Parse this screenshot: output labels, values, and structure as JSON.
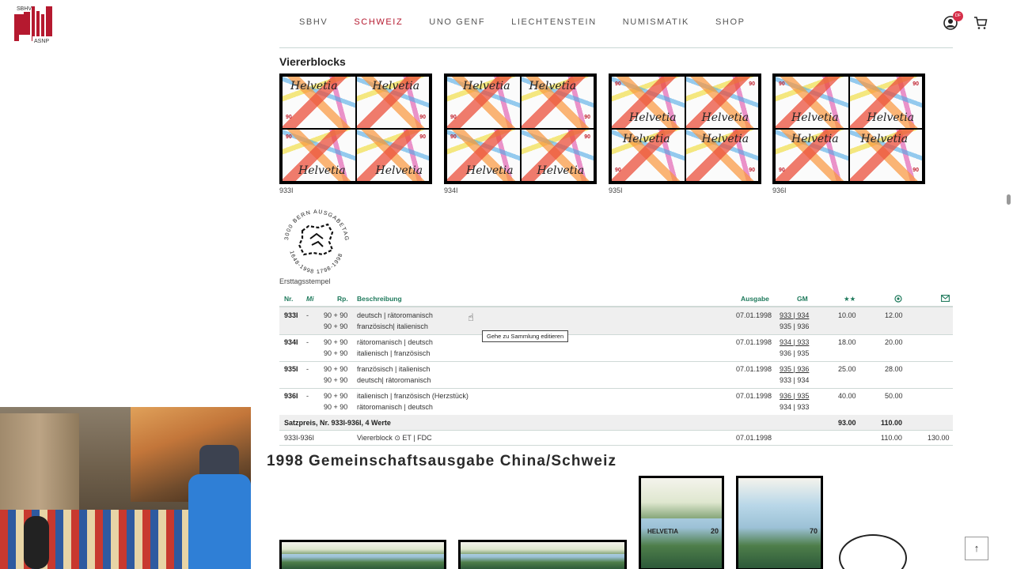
{
  "header": {
    "logo_top": "SBHV",
    "logo_bottom": "ASNP",
    "nav": [
      "SBHV",
      "SCHWEIZ",
      "UNO GENF",
      "LIECHTENSTEIN",
      "NUMISMATIK",
      "SHOP"
    ],
    "active_nav": "SCHWEIZ",
    "user_badge": "DF",
    "icons": [
      "user-icon",
      "cart-icon"
    ]
  },
  "section": {
    "title": "Viererblocks",
    "stamps": [
      {
        "caption": "933I",
        "value": "90"
      },
      {
        "caption": "934I",
        "value": "90"
      },
      {
        "caption": "935I",
        "value": "90"
      },
      {
        "caption": "936I",
        "value": "90"
      }
    ],
    "stamp_word": "Helvetia",
    "fdc_caption": "Ersttagsstempel",
    "fdc_text_top": "3000 BERN AUSGABETAG 1.1.1998",
    "fdc_text_bottom": "1648-1998 1798-1998"
  },
  "table": {
    "headers": {
      "nr": "Nr.",
      "mi": "Mi",
      "rp": "Rp.",
      "desc": "Beschreibung",
      "ausgabe": "Ausgabe",
      "gm": "GM",
      "stars": "★★"
    },
    "header_icons": [
      "circle-dot-icon",
      "envelope-icon"
    ],
    "rows": [
      {
        "nr": "933I",
        "mi": "-",
        "rp1": "90 + 90",
        "rp2": "90 + 90",
        "d1": "deutsch | rätoromanisch",
        "d2": "französisch| italienisch",
        "date": "07.01.1998",
        "gm1": "933 | 934",
        "gm2": "935 | 936",
        "v1": "10.00",
        "v2": "12.00"
      },
      {
        "nr": "934I",
        "mi": "-",
        "rp1": "90 + 90",
        "rp2": "90 + 90",
        "d1": "rätoromanisch | deutsch",
        "d2": "italienisch | französisch",
        "date": "07.01.1998",
        "gm1": "934 | 933",
        "gm2": "936 | 935",
        "v1": "18.00",
        "v2": "20.00"
      },
      {
        "nr": "935I",
        "mi": "-",
        "rp1": "90 + 90",
        "rp2": "90 + 90",
        "d1": "französisch | italienisch",
        "d2": "deutsch| rätoromanisch",
        "date": "07.01.1998",
        "gm1": "935 | 936",
        "gm2": "933 | 934",
        "v1": "25.00",
        "v2": "28.00"
      },
      {
        "nr": "936I",
        "mi": "-",
        "rp1": "90 + 90",
        "rp2": "90 + 90",
        "d1": "italienisch | französisch (Herzstück)",
        "d2": "rätoromanisch | deutsch",
        "date": "07.01.1998",
        "gm1": "936 | 935",
        "gm2": "934 | 933",
        "v1": "40.00",
        "v2": "50.00"
      }
    ],
    "satz": {
      "label": "Satzpreis, Nr. 933I-936I, 4 Werte",
      "v1": "93.00",
      "v2": "110.00"
    },
    "fdc_row": {
      "nr": "933I-936I",
      "desc": "Viererblock ⊙ ET | FDC",
      "date": "07.01.1998",
      "v2": "110.00",
      "v3": "130.00"
    },
    "tooltip": "Gehe zu Sammlung editieren"
  },
  "section2": {
    "title": "1998 Gemeinschaftsausgabe China/Schweiz",
    "stamp_label": "HELVETIA",
    "values": [
      "20",
      "70"
    ]
  },
  "back_to_top": "↑"
}
